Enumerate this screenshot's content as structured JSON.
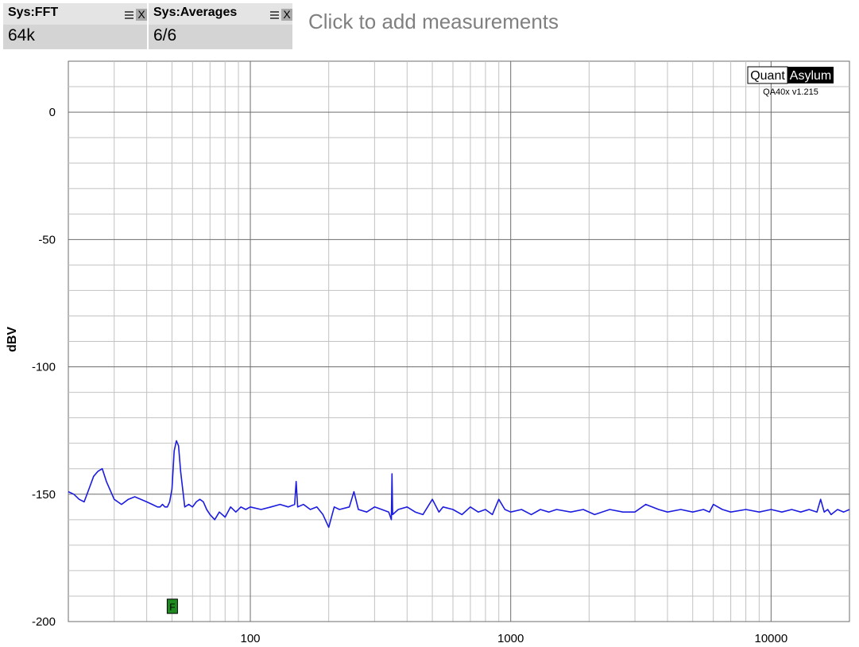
{
  "widgets": [
    {
      "title": "Sys:FFT",
      "value": "64k"
    },
    {
      "title": "Sys:Averages",
      "value": "6/6"
    }
  ],
  "close_label": "X",
  "add_measurements": "Click to add measurements",
  "logo": {
    "left": "Quant",
    "right": "Asylum",
    "version": "QA40x v1.215"
  },
  "marker_label": "F",
  "colors": {
    "trace": "#1c1ce0",
    "grid_major": "#6e6e6e",
    "grid_minor": "#c2c2c2",
    "marker": "#1f8a1f"
  },
  "chart_data": {
    "type": "line",
    "xscale": "log",
    "xlim": [
      20,
      20000
    ],
    "ylim": [
      -200,
      20
    ],
    "ylabel": "dBV",
    "xlabel": "",
    "grid": true,
    "x_ticks": [
      {
        "v": 100,
        "label": "100"
      },
      {
        "v": 1000,
        "label": "1000"
      },
      {
        "v": 10000,
        "label": "10000"
      }
    ],
    "y_ticks": [
      {
        "v": 0,
        "label": "0"
      },
      {
        "v": -50,
        "label": "-50"
      },
      {
        "v": -100,
        "label": "-100"
      },
      {
        "v": -150,
        "label": "-150"
      },
      {
        "v": -200,
        "label": "-200"
      }
    ],
    "marker": {
      "x": 50,
      "y": -194
    },
    "series": [
      {
        "values_desc": "",
        "x": [
          20,
          21,
          22,
          23,
          24,
          25,
          26,
          27,
          28,
          30,
          32,
          34,
          36,
          38,
          40,
          42,
          44,
          45,
          46,
          47,
          48,
          49,
          50,
          51,
          52,
          53,
          54,
          56,
          58,
          60,
          62,
          64,
          66,
          68,
          70,
          73,
          76,
          80,
          84,
          88,
          92,
          96,
          100,
          110,
          120,
          130,
          140,
          148,
          150,
          152,
          160,
          170,
          180,
          190,
          200,
          210,
          220,
          240,
          250,
          260,
          280,
          300,
          320,
          340,
          348,
          350,
          352,
          370,
          400,
          430,
          460,
          500,
          530,
          550,
          600,
          650,
          700,
          750,
          800,
          850,
          900,
          950,
          1000,
          1100,
          1200,
          1300,
          1400,
          1500,
          1700,
          1900,
          2100,
          2400,
          2700,
          3000,
          3300,
          3700,
          4000,
          4500,
          5000,
          5500,
          5800,
          6000,
          6500,
          7000,
          8000,
          9000,
          10000,
          11000,
          12000,
          13000,
          14000,
          15000,
          15500,
          16000,
          16500,
          17000,
          18000,
          19000,
          20000
        ],
        "y": [
          -149,
          -150,
          -152,
          -153,
          -148,
          -143,
          -141,
          -140,
          -145,
          -152,
          -154,
          -152,
          -151,
          -152,
          -153,
          -154,
          -155,
          -155,
          -154,
          -155,
          -155,
          -153,
          -148,
          -133,
          -129,
          -131,
          -141,
          -155,
          -154,
          -155,
          -153,
          -152,
          -153,
          -156,
          -158,
          -160,
          -157,
          -159,
          -155,
          -157,
          -155,
          -156,
          -155,
          -156,
          -155,
          -154,
          -155,
          -154,
          -145,
          -155,
          -154,
          -156,
          -155,
          -158,
          -163,
          -155,
          -156,
          -155,
          -149,
          -156,
          -157,
          -155,
          -156,
          -157,
          -160,
          -142,
          -158,
          -156,
          -155,
          -157,
          -158,
          -152,
          -157,
          -155,
          -156,
          -158,
          -155,
          -157,
          -156,
          -158,
          -152,
          -156,
          -157,
          -156,
          -158,
          -156,
          -157,
          -156,
          -157,
          -156,
          -158,
          -156,
          -157,
          -157,
          -154,
          -156,
          -157,
          -156,
          -157,
          -156,
          -157,
          -154,
          -156,
          -157,
          -156,
          -157,
          -156,
          -157,
          -156,
          -157,
          -156,
          -157,
          -152,
          -157,
          -156,
          -158,
          -156,
          -157,
          -156
        ]
      }
    ]
  }
}
